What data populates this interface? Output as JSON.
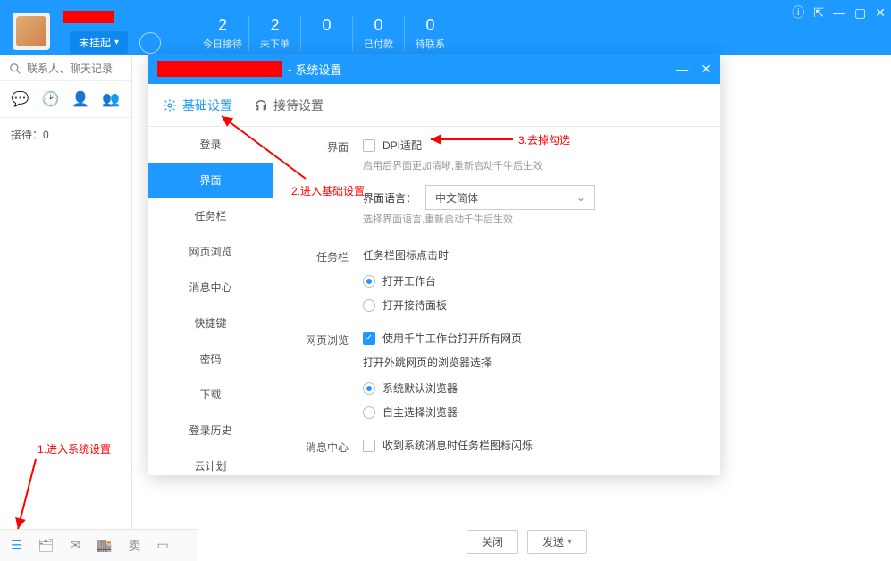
{
  "header": {
    "status_label": "未挂起",
    "stats": [
      {
        "num": "2",
        "label": "今日接待"
      },
      {
        "num": "2",
        "label": "未下单"
      },
      {
        "num": "0",
        "label": ""
      },
      {
        "num": "0",
        "label": "已付款"
      },
      {
        "num": "0",
        "label": "待联系"
      }
    ]
  },
  "left": {
    "search_placeholder": "联系人、聊天记录",
    "waiting": "接待：0"
  },
  "chat_footer": {
    "close": "关闭",
    "send": "发送"
  },
  "dialog": {
    "title_suffix": "系统设置",
    "tabs": {
      "basic": "基础设置",
      "reception": "接待设置"
    },
    "side_items": [
      "登录",
      "界面",
      "任务栏",
      "网页浏览",
      "消息中心",
      "快捷键",
      "密码",
      "下载",
      "登录历史",
      "云计划"
    ],
    "side_active_index": 1,
    "content": {
      "sect_ui": "界面",
      "dpi_label": "DPI适配",
      "dpi_hint": "启用后界面更加清晰,重新启动千牛后生效",
      "lang_label": "界面语言：",
      "lang_value": "中文简体",
      "lang_hint": "选择界面语言,重新启动千牛后生效",
      "sect_taskbar": "任务栏",
      "taskbar_title": "任务栏图标点击时",
      "taskbar_opt1": "打开工作台",
      "taskbar_opt2": "打开接待面板",
      "sect_web": "网页浏览",
      "web_check": "使用千牛工作台打开所有网页",
      "web_title": "打开外跳网页的浏览器选择",
      "web_opt1": "系统默认浏览器",
      "web_opt2": "自主选择浏览器",
      "sect_msg": "消息中心",
      "msg_check": "收到系统消息时任务栏图标闪烁"
    }
  },
  "annotations": {
    "a1": "1.进入系统设置",
    "a2": "2.进入基础设置",
    "a3": "3.去掉勾选"
  },
  "bottom_icons": {
    "sell": "卖"
  }
}
